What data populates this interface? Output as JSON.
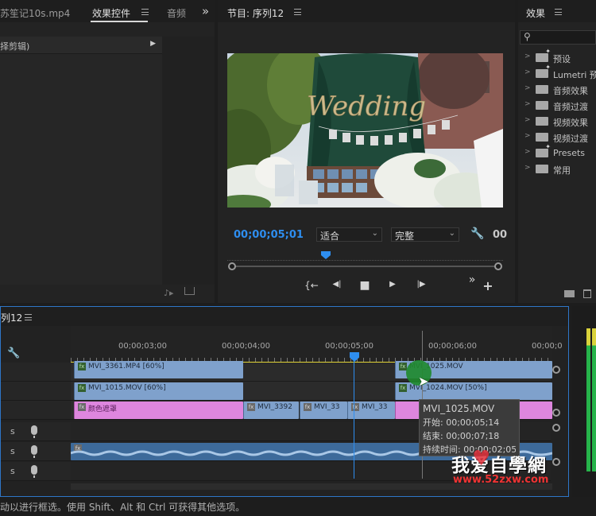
{
  "source_panel": {
    "tab_clip": "苏笙记10s.mp4",
    "tab_effect_controls": "效果控件",
    "tab_audio": "音频",
    "overflow": "»",
    "select_clip_text": "择剪辑)",
    "arrow": "▶"
  },
  "program_monitor": {
    "tab_label": "节目: 序列12",
    "timecode": "00;00;05;01",
    "fit_label": "适合",
    "quality_label": "完整",
    "end_timecode": "00",
    "image_title": "Wedding",
    "buttons": {
      "mark_in": "{←",
      "step_back": "◀|",
      "stop": "■",
      "play": "▶",
      "step_fwd": "|▶",
      "more": "»",
      "add": "+"
    }
  },
  "effects_panel": {
    "tab_label": "效果",
    "items": [
      {
        "label": "预设",
        "star": true
      },
      {
        "label": "Lumetri 预",
        "star": true
      },
      {
        "label": "音频效果",
        "star": false
      },
      {
        "label": "音频过渡",
        "star": false
      },
      {
        "label": "视频效果",
        "star": false
      },
      {
        "label": "视频过渡",
        "star": false
      },
      {
        "label": "Presets",
        "star": true
      },
      {
        "label": "常用",
        "star": false
      }
    ]
  },
  "timeline": {
    "tab_label": "列12",
    "ruler_times": [
      "00;00;03;00",
      "00;00;04;00",
      "00;00;05;00",
      "00;00;06;00",
      "00;00;0"
    ],
    "v3_clips": [
      {
        "name": "MVI_3361.MP4 [60%]"
      },
      {
        "name": "MVI_1025.MOV"
      }
    ],
    "v2_clips": [
      {
        "name": "MVI_1015.MOV [60%]"
      },
      {
        "name": "MVI_1024.MOV [50%]"
      }
    ],
    "v1_clips": [
      {
        "name": "颜色遮罩"
      },
      {
        "name": "MVI_3392"
      },
      {
        "name": "MVI_33"
      },
      {
        "name": "MVI_33"
      }
    ],
    "audio_headers": [
      {
        "s": "s"
      },
      {
        "s": "s"
      },
      {
        "s": "s"
      }
    ],
    "tooltip": {
      "title": "MVI_1025.MOV",
      "start": "开始: 00;00;05;14",
      "end": "结束: 00;00;07;18",
      "duration": "持续时间: 00;00;02;05"
    }
  },
  "watermark": {
    "brand": "我爱自學網",
    "url": "www.52zxw.com"
  },
  "status_bar": {
    "text": "动以进行框选。使用 Shift、Alt 和 Ctrl 可获得其他选项。"
  }
}
